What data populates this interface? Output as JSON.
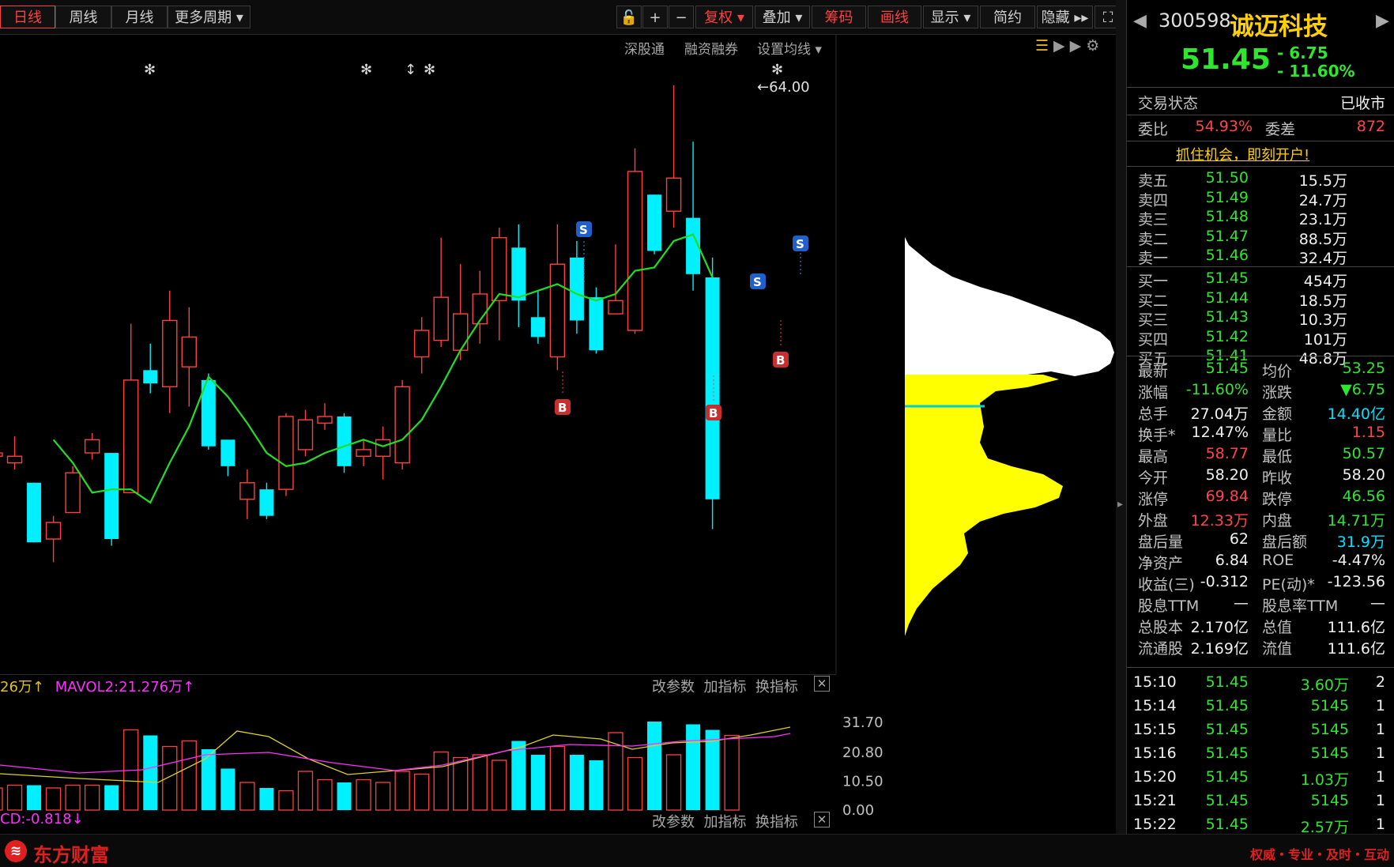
{
  "toolbar": {
    "periods": [
      "日线",
      "周线",
      "月线",
      "更多周期"
    ],
    "tools": [
      "复权",
      "叠加",
      "筹码",
      "画线",
      "显示",
      "简约",
      "隐藏"
    ],
    "links": [
      "深股通",
      "融资融券",
      "设置均线"
    ]
  },
  "chart": {
    "y_ticks": [
      "64.00",
      "63.00",
      "62.00",
      "61.00",
      "60.00",
      "59.00",
      "58.00",
      "57.00",
      "56.00",
      "55.00",
      "54.00",
      "53.00",
      "52.00",
      "51.00",
      "50.00",
      "49.00"
    ],
    "high_marker": "←64.00",
    "colors": {
      "up": "#ff4040",
      "down": "#00f0ff",
      "ma": "#22dd22"
    },
    "candles": [
      {
        "o": 52.8,
        "c": 52.9,
        "h": 53.1,
        "l": 52.4
      },
      {
        "o": 52.6,
        "c": 52.8,
        "h": 53.4,
        "l": 52.4
      },
      {
        "o": 52.0,
        "c": 50.2,
        "h": 52.0,
        "l": 50.2
      },
      {
        "o": 50.3,
        "c": 50.8,
        "h": 51.0,
        "l": 49.6
      },
      {
        "o": 51.1,
        "c": 52.3,
        "h": 52.5,
        "l": 51.1
      },
      {
        "o": 52.9,
        "c": 53.3,
        "h": 53.5,
        "l": 52.7
      },
      {
        "o": 52.9,
        "c": 50.3,
        "h": 52.9,
        "l": 50.1
      },
      {
        "o": 51.7,
        "c": 55.1,
        "h": 56.8,
        "l": 51.7
      },
      {
        "o": 55.4,
        "c": 55.0,
        "h": 56.2,
        "l": 54.7
      },
      {
        "o": 54.9,
        "c": 56.9,
        "h": 57.8,
        "l": 54.1
      },
      {
        "o": 55.5,
        "c": 56.4,
        "h": 57.3,
        "l": 54.3
      },
      {
        "o": 55.1,
        "c": 53.1,
        "h": 55.3,
        "l": 53.0
      },
      {
        "o": 53.3,
        "c": 52.5,
        "h": 53.3,
        "l": 52.2
      },
      {
        "o": 51.5,
        "c": 52.0,
        "h": 52.4,
        "l": 50.9
      },
      {
        "o": 51.8,
        "c": 51.0,
        "h": 52.0,
        "l": 50.9
      },
      {
        "o": 51.8,
        "c": 54.0,
        "h": 54.1,
        "l": 51.6
      },
      {
        "o": 53.0,
        "c": 53.9,
        "h": 54.2,
        "l": 52.8
      },
      {
        "o": 53.8,
        "c": 54.0,
        "h": 54.4,
        "l": 53.6
      },
      {
        "o": 54.0,
        "c": 52.5,
        "h": 54.1,
        "l": 52.3
      },
      {
        "o": 52.8,
        "c": 53.0,
        "h": 53.3,
        "l": 52.5
      },
      {
        "o": 52.8,
        "c": 53.3,
        "h": 53.7,
        "l": 52.1
      },
      {
        "o": 52.6,
        "c": 54.9,
        "h": 55.1,
        "l": 52.4
      },
      {
        "o": 55.8,
        "c": 56.6,
        "h": 57.0,
        "l": 55.3
      },
      {
        "o": 56.3,
        "c": 57.6,
        "h": 59.4,
        "l": 56.1
      },
      {
        "o": 56.0,
        "c": 57.1,
        "h": 58.6,
        "l": 55.7
      },
      {
        "o": 56.8,
        "c": 57.7,
        "h": 58.4,
        "l": 56.2
      },
      {
        "o": 57.5,
        "c": 59.4,
        "h": 59.7,
        "l": 56.3
      },
      {
        "o": 59.1,
        "c": 57.5,
        "h": 59.8,
        "l": 56.7
      },
      {
        "o": 57.0,
        "c": 56.4,
        "h": 57.8,
        "l": 56.2
      },
      {
        "o": 55.8,
        "c": 58.6,
        "h": 59.8,
        "l": 55.4
      },
      {
        "o": 58.8,
        "c": 56.9,
        "h": 59.3,
        "l": 56.5
      },
      {
        "o": 57.6,
        "c": 56.0,
        "h": 57.9,
        "l": 55.9
      },
      {
        "o": 57.1,
        "c": 57.5,
        "h": 59.2,
        "l": 57.1
      },
      {
        "o": 56.6,
        "c": 61.4,
        "h": 62.1,
        "l": 56.5
      },
      {
        "o": 60.7,
        "c": 59.0,
        "h": 60.7,
        "l": 58.9
      },
      {
        "o": 60.2,
        "c": 61.2,
        "h": 64.0,
        "l": 59.7
      },
      {
        "o": 60.0,
        "c": 58.3,
        "h": 62.3,
        "l": 57.8
      },
      {
        "o": 58.2,
        "c": 51.5,
        "h": 58.8,
        "l": 50.6
      }
    ],
    "ma": [
      53.3,
      52.6,
      51.7,
      51.8,
      51.8,
      51.4,
      52.6,
      53.7,
      55.2,
      54.6,
      53.8,
      52.9,
      52.5,
      52.6,
      52.9,
      53.1,
      53.3,
      53.1,
      53.3,
      53.9,
      54.9,
      56.0,
      56.9,
      57.7,
      57.6,
      57.8,
      58.0,
      57.7,
      57.5,
      57.7,
      58.4,
      58.5,
      59.3,
      59.5,
      58.2
    ]
  },
  "volume": {
    "label_left": "26万↑",
    "label_mavol": "MAVOL2:21.276万↑",
    "macd_label": "CD:-0.818↓",
    "ticks": [
      "31.70",
      "20.80",
      "10.50",
      "0.00"
    ],
    "buttons": [
      "改参数",
      "加指标",
      "换指标"
    ],
    "values": [
      8,
      9,
      9,
      8,
      9,
      9,
      9,
      29,
      27,
      23,
      25,
      22,
      15,
      10,
      8,
      7,
      14,
      11,
      10,
      11,
      10,
      14,
      13,
      21,
      19,
      20,
      18,
      25,
      20,
      23,
      20,
      18,
      28,
      19,
      32,
      20,
      31,
      29,
      27
    ]
  },
  "stock": {
    "code": "300598",
    "name": "诚迈科技",
    "price": "51.45",
    "change": "- 6.75",
    "change_pct": "- 11.60%",
    "status_label": "交易状态",
    "status_value": "已收市",
    "weibi_label": "委比",
    "weibi_value": "54.93%",
    "weicha_label": "委差",
    "weicha_value": "872",
    "promo": "抓住机会，即刻开户!",
    "sells": [
      {
        "label": "卖五",
        "price": "51.50",
        "vol": "15.5万"
      },
      {
        "label": "卖四",
        "price": "51.49",
        "vol": "24.7万"
      },
      {
        "label": "卖三",
        "price": "51.48",
        "vol": "23.1万"
      },
      {
        "label": "卖二",
        "price": "51.47",
        "vol": "88.5万"
      },
      {
        "label": "卖一",
        "price": "51.46",
        "vol": "32.4万"
      }
    ],
    "buys": [
      {
        "label": "买一",
        "price": "51.45",
        "vol": "454万"
      },
      {
        "label": "买二",
        "price": "51.44",
        "vol": "18.5万"
      },
      {
        "label": "买三",
        "price": "51.43",
        "vol": "10.3万"
      },
      {
        "label": "买四",
        "price": "51.42",
        "vol": "101万"
      },
      {
        "label": "买五",
        "price": "51.41",
        "vol": "48.8万"
      }
    ],
    "stats": [
      {
        "l1": "最新",
        "v1": "51.45",
        "c1": "green",
        "l2": "均价",
        "v2": "53.25",
        "c2": "green"
      },
      {
        "l1": "涨幅",
        "v1": "-11.60%",
        "c1": "green",
        "l2": "涨跌",
        "v2": "▼6.75",
        "c2": "green"
      },
      {
        "l1": "总手",
        "v1": "27.04万",
        "c1": "white",
        "l2": "金额",
        "v2": "14.40亿",
        "c2": "cyan"
      },
      {
        "l1": "换手*",
        "v1": "12.47%",
        "c1": "white",
        "l2": "量比",
        "v2": "1.15",
        "c2": "red"
      },
      {
        "l1": "最高",
        "v1": "58.77",
        "c1": "red",
        "l2": "最低",
        "v2": "50.57",
        "c2": "green"
      },
      {
        "l1": "今开",
        "v1": "58.20",
        "c1": "white",
        "l2": "昨收",
        "v2": "58.20",
        "c2": "white"
      },
      {
        "l1": "涨停",
        "v1": "69.84",
        "c1": "red",
        "l2": "跌停",
        "v2": "46.56",
        "c2": "green"
      },
      {
        "l1": "外盘",
        "v1": "12.33万",
        "c1": "red",
        "l2": "内盘",
        "v2": "14.71万",
        "c2": "green"
      },
      {
        "l1": "盘后量",
        "v1": "62",
        "c1": "white",
        "l2": "盘后额",
        "v2": "31.9万",
        "c2": "cyan"
      },
      {
        "l1": "净资产",
        "v1": "6.84",
        "c1": "white",
        "l2": "ROE",
        "v2": "-4.47%",
        "c2": "white"
      },
      {
        "l1": "收益(三)",
        "v1": "-0.312",
        "c1": "white",
        "l2": "PE(动)*",
        "v2": "-123.56",
        "c2": "white"
      },
      {
        "l1": "股息TTM",
        "v1": "—",
        "c1": "white",
        "l2": "股息率TTM",
        "v2": "—",
        "c2": "white"
      },
      {
        "l1": "总股本",
        "v1": "2.170亿",
        "c1": "white",
        "l2": "总值",
        "v2": "111.6亿",
        "c2": "white"
      },
      {
        "l1": "流通股",
        "v1": "2.169亿",
        "c1": "white",
        "l2": "流值",
        "v2": "111.6亿",
        "c2": "white"
      }
    ],
    "trades": [
      {
        "time": "15:10",
        "price": "51.45",
        "vol": "3.60万",
        "n": "2"
      },
      {
        "time": "15:14",
        "price": "51.45",
        "vol": "5145",
        "n": "1"
      },
      {
        "time": "15:15",
        "price": "51.45",
        "vol": "5145",
        "n": "1"
      },
      {
        "time": "15:16",
        "price": "51.45",
        "vol": "5145",
        "n": "1"
      },
      {
        "time": "15:20",
        "price": "51.45",
        "vol": "1.03万",
        "n": "1"
      },
      {
        "time": "15:21",
        "price": "51.45",
        "vol": "5145",
        "n": "1"
      },
      {
        "time": "15:22",
        "price": "51.45",
        "vol": "2.57万",
        "n": "1"
      }
    ]
  },
  "footer": {
    "brand": "东方财富",
    "slogan": "权威・专业・及时・互动"
  }
}
